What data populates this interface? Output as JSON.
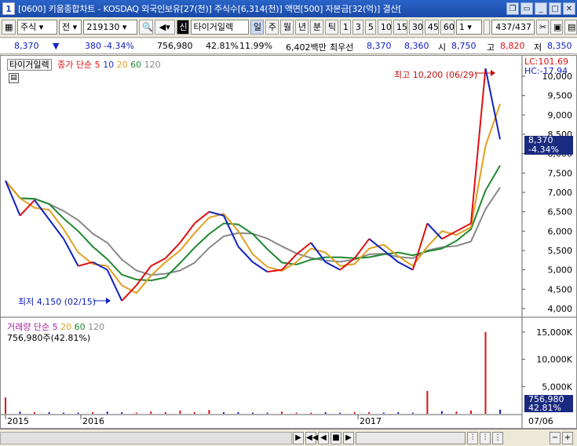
{
  "window": {
    "number": "1",
    "title": "[0600] 키움종합차트 - KOSDAQ 외국인보유[27(천)] 주식수[6,314(천)] 액면[500] 자본금[32(억)] 결산["
  },
  "toolbar": {
    "market": "주식",
    "jeon": "전",
    "code": "219130",
    "sin": "신",
    "stock_name": "타이거일렉",
    "periods": [
      "일",
      "주",
      "월",
      "년",
      "분",
      "틱"
    ],
    "intervals": [
      "1",
      "3",
      "5",
      "10",
      "15",
      "30",
      "45",
      "60"
    ],
    "interval_select": "1",
    "count": "437",
    "total": "/437"
  },
  "quote": {
    "price": "8,370",
    "change_arrow": "▼",
    "change": "380",
    "change_pct": "-4.34%",
    "volume": "756,980",
    "vol_ratio": "42.81%",
    "turnover": "11.99%",
    "amount": "6,402백만",
    "best_ask_label": "최우선",
    "best_ask": "8,370",
    "best_bid": "8,360",
    "open_label": "시",
    "open": "8,750",
    "high_label": "고",
    "high": "8,820",
    "low_label": "저",
    "low": "8,350"
  },
  "price_legend": {
    "name": "타이거일렉",
    "label": "종가 단순",
    "ma": [
      "5",
      "10",
      "20",
      "60",
      "120"
    ]
  },
  "volume_legend": {
    "label": "거래량 단순",
    "ma": [
      "5",
      "20",
      "60",
      "120"
    ],
    "value": "756,980주(42.81%)"
  },
  "right_axis": {
    "lc": "LC:101.69",
    "hc": "HC:-17.94",
    "current": "8,370",
    "current_pct": "-4.34%",
    "price_ticks": [
      "10,000",
      "9,500",
      "9,000",
      "8,500",
      "8,000",
      "7,500",
      "7,000",
      "6,500",
      "6,000",
      "5,500",
      "5,000",
      "4,500",
      "4,000"
    ],
    "volume_ticks": [
      "15,000K",
      "10,000K",
      "5,000K"
    ],
    "vol_current": "756,980",
    "vol_pct": "42.81%"
  },
  "annotations": {
    "high": "최고 10,200 (06/29)",
    "low": "최저 4,150 (02/15)"
  },
  "x_axis": {
    "labels": [
      "2015",
      "2016",
      "2017"
    ],
    "right_date": "07/06"
  },
  "colors": {
    "up": "#e01010",
    "down": "#1020c0",
    "ma5": "#e02020",
    "ma10": "#2030c0",
    "ma20": "#e0a020",
    "ma60": "#208830",
    "ma120": "#888888"
  },
  "chart_data": {
    "type": "line",
    "title": "",
    "xlabel": "",
    "ylabel": "",
    "ylim": [
      4000,
      10200
    ],
    "x": [
      "2015",
      "2016",
      "2017",
      "07/06"
    ],
    "series": [
      {
        "name": "종가",
        "values": [
          7300,
          6400,
          6800,
          6300,
          5800,
          5100,
          5200,
          5000,
          4200,
          4600,
          5100,
          5300,
          5700,
          6200,
          6500,
          6400,
          5600,
          5200,
          4950,
          5000,
          5400,
          5700,
          5200,
          5000,
          5300,
          5800,
          5500,
          5200,
          5000,
          6200,
          5800,
          6000,
          6200,
          10200,
          8370
        ]
      },
      {
        "name": "거래량",
        "values": [
          3000,
          400,
          300,
          300,
          200,
          200,
          300,
          400,
          300,
          200,
          400,
          300,
          600,
          300,
          700,
          300,
          300,
          200,
          200,
          400,
          200,
          200,
          300,
          200,
          300,
          300,
          200,
          300,
          200,
          4200,
          500,
          400,
          600,
          15000,
          756.98
        ]
      }
    ]
  }
}
